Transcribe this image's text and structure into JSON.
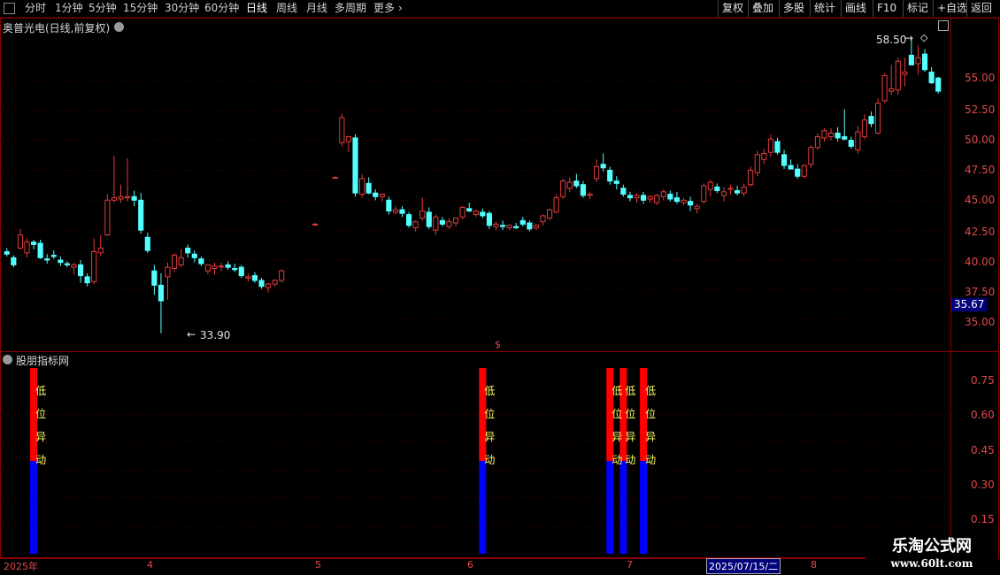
{
  "toolbar": {
    "periods": [
      "分时",
      "1分钟",
      "5分钟",
      "15分钟",
      "30分钟",
      "60分钟",
      "日线",
      "周线",
      "月线",
      "多周期",
      "更多"
    ],
    "active_period": "日线",
    "right_buttons": [
      "复权",
      "叠加",
      "多股",
      "统计",
      "画线",
      "F10",
      "标记",
      "+自选",
      "返回"
    ]
  },
  "main_pane": {
    "title": "奥普光电(日线,前复权)",
    "high_label": "58.50",
    "low_label": "33.90",
    "current_price": "35.67",
    "y_ticks": [
      "55.00",
      "52.50",
      "50.00",
      "47.50",
      "45.00",
      "42.50",
      "40.00",
      "37.50",
      "35.00"
    ],
    "marker_symbol": "$"
  },
  "indicator_pane": {
    "title": "股朋指标网",
    "y_ticks": [
      "0.75",
      "0.60",
      "0.45",
      "0.30",
      "0.15"
    ],
    "signal_text": [
      "低",
      "位",
      "异",
      "动"
    ]
  },
  "date_axis": {
    "labels": [
      "2025年",
      "4",
      "5",
      "6",
      "7",
      "8"
    ],
    "selected_date": "2025/07/15/二"
  },
  "watermark": {
    "title": "乐淘公式网",
    "url": "www.60lt.com"
  },
  "colors": {
    "up": "#e23b3b",
    "down": "#54ffff",
    "axis": "#8b0000",
    "signal_top": "#ff0000",
    "signal_bottom": "#0000ff"
  },
  "chart_data": {
    "type": "candlestick",
    "y_range": [
      33.5,
      59.5
    ],
    "candles": [
      [
        40.7,
        41.0,
        40.3,
        40.5
      ],
      [
        40.2,
        40.4,
        39.4,
        39.6
      ],
      [
        41.0,
        42.6,
        40.9,
        42.1
      ],
      [
        40.6,
        41.8,
        40.2,
        41.5
      ],
      [
        41.5,
        41.7,
        40.9,
        41.3
      ],
      [
        41.4,
        41.7,
        40.1,
        40.2
      ],
      [
        40.1,
        40.5,
        39.7,
        40.0
      ],
      [
        40.4,
        40.8,
        40.1,
        40.3
      ],
      [
        40.0,
        40.3,
        39.5,
        39.8
      ],
      [
        39.7,
        39.9,
        39.4,
        39.6
      ],
      [
        39.4,
        39.8,
        38.8,
        39.6
      ],
      [
        39.6,
        40.0,
        38.1,
        38.7
      ],
      [
        38.6,
        38.9,
        37.8,
        38.1
      ],
      [
        38.2,
        41.8,
        38.0,
        40.7
      ],
      [
        40.6,
        42.1,
        40.3,
        41.0
      ],
      [
        42.1,
        45.5,
        42.0,
        45.0
      ],
      [
        45.0,
        48.7,
        44.8,
        45.2
      ],
      [
        45.1,
        46.3,
        44.8,
        45.3
      ],
      [
        45.2,
        48.5,
        44.9,
        45.3
      ],
      [
        45.3,
        45.8,
        44.5,
        45.0
      ],
      [
        45.0,
        45.6,
        42.2,
        42.5
      ],
      [
        41.9,
        42.3,
        40.6,
        40.8
      ],
      [
        39.1,
        39.6,
        37.1,
        37.9
      ],
      [
        37.9,
        38.9,
        33.9,
        36.6
      ],
      [
        38.6,
        39.8,
        36.7,
        39.4
      ],
      [
        39.3,
        40.6,
        39.0,
        40.4
      ],
      [
        39.6,
        40.9,
        39.4,
        40.2
      ],
      [
        41.0,
        41.3,
        40.2,
        40.6
      ],
      [
        40.5,
        40.8,
        39.8,
        40.2
      ],
      [
        40.1,
        40.3,
        39.5,
        39.7
      ],
      [
        39.1,
        39.6,
        38.8,
        39.6
      ],
      [
        39.3,
        39.8,
        38.8,
        39.5
      ],
      [
        39.5,
        39.8,
        39.1,
        39.5
      ],
      [
        39.6,
        39.9,
        39.2,
        39.4
      ],
      [
        39.3,
        39.7,
        39.0,
        39.2
      ],
      [
        39.4,
        39.6,
        38.5,
        38.7
      ],
      [
        38.5,
        38.9,
        38.2,
        38.6
      ],
      [
        38.7,
        39.0,
        38.1,
        38.3
      ],
      [
        38.3,
        38.5,
        37.6,
        37.8
      ],
      [
        37.7,
        38.1,
        37.3,
        38.0
      ],
      [
        38.0,
        38.4,
        37.8,
        38.3
      ],
      [
        38.3,
        39.2,
        38.1,
        39.1
      ],
      [
        null,
        null,
        null,
        null
      ],
      [
        null,
        null,
        null,
        null
      ],
      [
        null,
        null,
        null,
        null
      ],
      [
        null,
        null,
        null,
        null
      ],
      [
        43.0,
        43.1,
        42.9,
        43.0
      ],
      [
        null,
        null,
        null,
        null
      ],
      [
        null,
        null,
        null,
        null
      ],
      [
        46.9,
        47.0,
        46.8,
        46.9
      ],
      [
        49.8,
        52.2,
        49.5,
        51.9
      ],
      [
        49.9,
        50.4,
        49.0,
        50.3
      ],
      [
        50.2,
        50.5,
        45.3,
        45.6
      ],
      [
        45.5,
        47.2,
        45.2,
        46.8
      ],
      [
        46.4,
        46.9,
        45.5,
        45.6
      ],
      [
        45.6,
        45.9,
        45.0,
        45.3
      ],
      [
        45.3,
        45.6,
        44.9,
        45.5
      ],
      [
        45.0,
        45.3,
        43.8,
        44.1
      ],
      [
        44.0,
        44.5,
        43.8,
        44.2
      ],
      [
        44.2,
        44.5,
        43.6,
        43.9
      ],
      [
        43.8,
        44.0,
        42.7,
        42.9
      ],
      [
        42.7,
        43.3,
        42.4,
        43.2
      ],
      [
        43.5,
        45.2,
        43.3,
        44.1
      ],
      [
        44.0,
        44.4,
        42.6,
        42.8
      ],
      [
        42.5,
        43.8,
        42.1,
        43.6
      ],
      [
        43.3,
        43.6,
        42.8,
        43.0
      ],
      [
        42.8,
        43.5,
        42.6,
        43.2
      ],
      [
        43.1,
        43.6,
        42.8,
        43.5
      ],
      [
        43.6,
        44.5,
        43.4,
        44.4
      ],
      [
        44.3,
        44.8,
        44.0,
        44.1
      ],
      [
        43.8,
        44.2,
        43.6,
        44.1
      ],
      [
        44.0,
        44.3,
        43.5,
        43.7
      ],
      [
        43.9,
        44.1,
        42.6,
        42.9
      ],
      [
        42.8,
        43.2,
        42.5,
        43.0
      ],
      [
        42.9,
        43.3,
        42.5,
        42.8
      ],
      [
        42.7,
        43.0,
        42.5,
        42.9
      ],
      [
        42.8,
        43.1,
        42.6,
        42.7
      ],
      [
        43.3,
        43.6,
        42.8,
        43.0
      ],
      [
        43.1,
        43.3,
        42.4,
        42.6
      ],
      [
        42.7,
        43.0,
        42.5,
        42.9
      ],
      [
        43.2,
        43.8,
        42.9,
        43.7
      ],
      [
        43.5,
        44.3,
        43.3,
        44.2
      ],
      [
        44.0,
        45.5,
        43.9,
        45.2
      ],
      [
        45.3,
        46.8,
        45.1,
        46.6
      ],
      [
        46.0,
        46.9,
        45.7,
        46.5
      ],
      [
        46.6,
        47.2,
        46.0,
        46.2
      ],
      [
        46.3,
        46.6,
        45.2,
        45.4
      ],
      [
        45.4,
        45.7,
        45.1,
        45.5
      ],
      [
        46.8,
        48.4,
        46.5,
        47.8
      ],
      [
        48.0,
        48.9,
        47.4,
        47.7
      ],
      [
        47.5,
        47.8,
        46.3,
        46.6
      ],
      [
        46.6,
        47.0,
        45.9,
        46.4
      ],
      [
        46.0,
        46.3,
        45.3,
        45.5
      ],
      [
        45.4,
        45.7,
        44.9,
        45.2
      ],
      [
        45.2,
        45.6,
        44.8,
        45.4
      ],
      [
        45.4,
        45.7,
        44.7,
        45.0
      ],
      [
        45.1,
        45.4,
        44.8,
        45.3
      ],
      [
        44.8,
        45.5,
        44.6,
        45.4
      ],
      [
        45.3,
        45.9,
        45.0,
        45.7
      ],
      [
        45.5,
        45.8,
        44.9,
        45.1
      ],
      [
        45.2,
        45.7,
        44.7,
        44.9
      ],
      [
        44.8,
        45.2,
        44.6,
        45.0
      ],
      [
        44.9,
        45.3,
        44.1,
        44.6
      ],
      [
        44.3,
        44.7,
        43.9,
        44.5
      ],
      [
        44.9,
        46.4,
        44.7,
        46.2
      ],
      [
        45.9,
        46.7,
        45.3,
        46.5
      ],
      [
        46.1,
        46.4,
        45.6,
        45.8
      ],
      [
        45.4,
        46.1,
        44.9,
        45.7
      ],
      [
        45.9,
        46.3,
        45.5,
        46.0
      ],
      [
        45.8,
        46.2,
        45.4,
        45.6
      ],
      [
        45.6,
        46.4,
        45.3,
        46.1
      ],
      [
        46.3,
        47.8,
        46.1,
        47.5
      ],
      [
        47.3,
        49.1,
        47.0,
        48.8
      ],
      [
        48.4,
        49.3,
        48.0,
        48.9
      ],
      [
        49.0,
        50.5,
        48.6,
        50.1
      ],
      [
        49.9,
        50.2,
        48.8,
        49.0
      ],
      [
        48.8,
        49.2,
        47.6,
        47.9
      ],
      [
        47.9,
        48.4,
        47.6,
        47.6
      ],
      [
        47.6,
        48.0,
        46.8,
        47.0
      ],
      [
        47.0,
        48.0,
        46.8,
        47.9
      ],
      [
        48.0,
        49.6,
        47.7,
        49.4
      ],
      [
        49.4,
        50.6,
        49.2,
        50.3
      ],
      [
        50.2,
        51.0,
        49.9,
        50.8
      ],
      [
        50.3,
        51.0,
        50.0,
        50.6
      ],
      [
        50.6,
        51.1,
        49.9,
        50.2
      ],
      [
        50.3,
        52.6,
        50.0,
        50.1
      ],
      [
        50.0,
        50.3,
        49.3,
        49.5
      ],
      [
        49.2,
        51.2,
        48.9,
        50.7
      ],
      [
        50.3,
        52.2,
        50.1,
        51.7
      ],
      [
        52.0,
        52.4,
        51.1,
        51.4
      ],
      [
        50.6,
        53.5,
        50.5,
        53.1
      ],
      [
        53.3,
        55.6,
        53.1,
        55.4
      ],
      [
        54.1,
        56.3,
        53.8,
        54.3
      ],
      [
        54.2,
        56.9,
        53.8,
        56.6
      ],
      [
        55.5,
        56.9,
        54.5,
        55.7
      ],
      [
        57.1,
        58.5,
        56.4,
        56.3
      ],
      [
        56.4,
        57.9,
        55.5,
        56.9
      ],
      [
        57.2,
        57.6,
        55.7,
        55.9
      ],
      [
        55.7,
        56.1,
        54.7,
        54.8
      ],
      [
        55.2,
        55.3,
        53.9,
        54.1
      ]
    ],
    "indicator_y_range": [
      0.0,
      1.0
    ],
    "signals": [
      4,
      71,
      90,
      92,
      95
    ]
  }
}
